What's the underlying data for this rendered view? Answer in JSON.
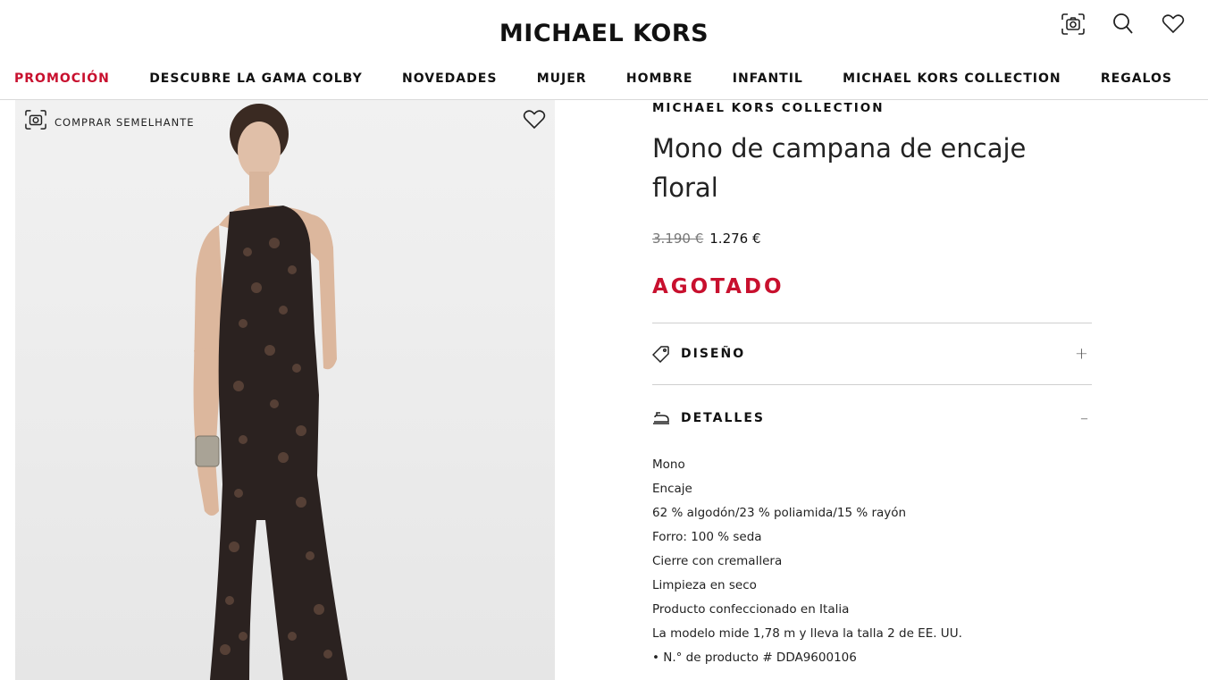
{
  "header": {
    "logo": "MICHAEL KORS",
    "icons": [
      "camera-search-icon",
      "search-icon",
      "heart-icon"
    ]
  },
  "nav": {
    "items": [
      {
        "label": "PROMOCIÓN",
        "accent": "#c8102e"
      },
      {
        "label": "DESCUBRE LA GAMA COLBY"
      },
      {
        "label": "NOVEDADES"
      },
      {
        "label": "MUJER"
      },
      {
        "label": "HOMBRE"
      },
      {
        "label": "INFANTIL"
      },
      {
        "label": "MICHAEL KORS COLLECTION"
      },
      {
        "label": "REGALOS"
      }
    ]
  },
  "image_panel": {
    "shop_similar_label": "COMPRAR SEMELHANTE",
    "icons": [
      "camera-search-icon",
      "heart-icon"
    ]
  },
  "product": {
    "brand": "MICHAEL KORS COLLECTION",
    "title": "Mono de campana de encaje floral",
    "price_old": "3.190 €",
    "price_new": "1.276 €",
    "status": "AGOTADO",
    "status_color": "#c8102e",
    "sections": [
      {
        "label": "DISEÑO",
        "icon": "tag-icon",
        "toggle": "+",
        "expanded": false
      },
      {
        "label": "DETALLES",
        "icon": "iron-icon",
        "toggle": "–",
        "expanded": true
      }
    ],
    "details": [
      "Mono",
      "Encaje",
      "62 % algodón/23 % poliamida/15 % rayón",
      "Forro: 100 % seda",
      "Cierre con cremallera",
      "Limpieza en seco",
      "Producto confeccionado en Italia",
      "La modelo mide 1,78 m y lleva la talla 2 de EE. UU.",
      "• N.° de producto # DDA9600106"
    ]
  }
}
